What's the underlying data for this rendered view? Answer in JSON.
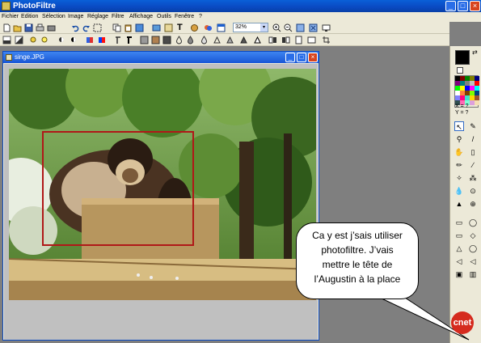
{
  "app": {
    "title": "PhotoFiltre",
    "window_controls": {
      "minimize": "_",
      "maximize": "□",
      "close": "×"
    }
  },
  "menu": {
    "items": [
      "Fichier",
      "Edition",
      "Sélection",
      "Image",
      "Réglage",
      "Filtre",
      "Affichage",
      "Outils",
      "Fenêtre",
      "?"
    ]
  },
  "toolbar": {
    "zoom_value": "32%",
    "zoom_arrow": "▾"
  },
  "document": {
    "title": "singe.JPG",
    "controls": {
      "minimize": "_",
      "maximize": "□",
      "close": "×"
    }
  },
  "palette": {
    "swap_icon": "⇄",
    "info_x": "X = ?",
    "info_y": "Y = ?",
    "tools": [
      "↖",
      "✎",
      "⚲",
      "/",
      "✋",
      "▯",
      "✏",
      "∕",
      "✧",
      "⁂",
      "💧",
      "⊙",
      "▲",
      "⊕"
    ],
    "shapes": [
      "▭",
      "◯",
      "▭",
      "◇",
      "△",
      "◯",
      "◁",
      "◁",
      "▣",
      "▥"
    ]
  },
  "bubble": {
    "lines": [
      "Ca y est j’sais utiliser",
      "photofiltre. J’vais",
      "mettre le tête de",
      "l’Augustin à la place"
    ]
  },
  "watermark": {
    "logo_text": "cnet"
  },
  "colors": {
    "titlebar": "#0a49c1",
    "selection": "#b01818",
    "workspace": "#7f7f7f",
    "chrome": "#ece9d8",
    "logo": "#d52b1e"
  }
}
